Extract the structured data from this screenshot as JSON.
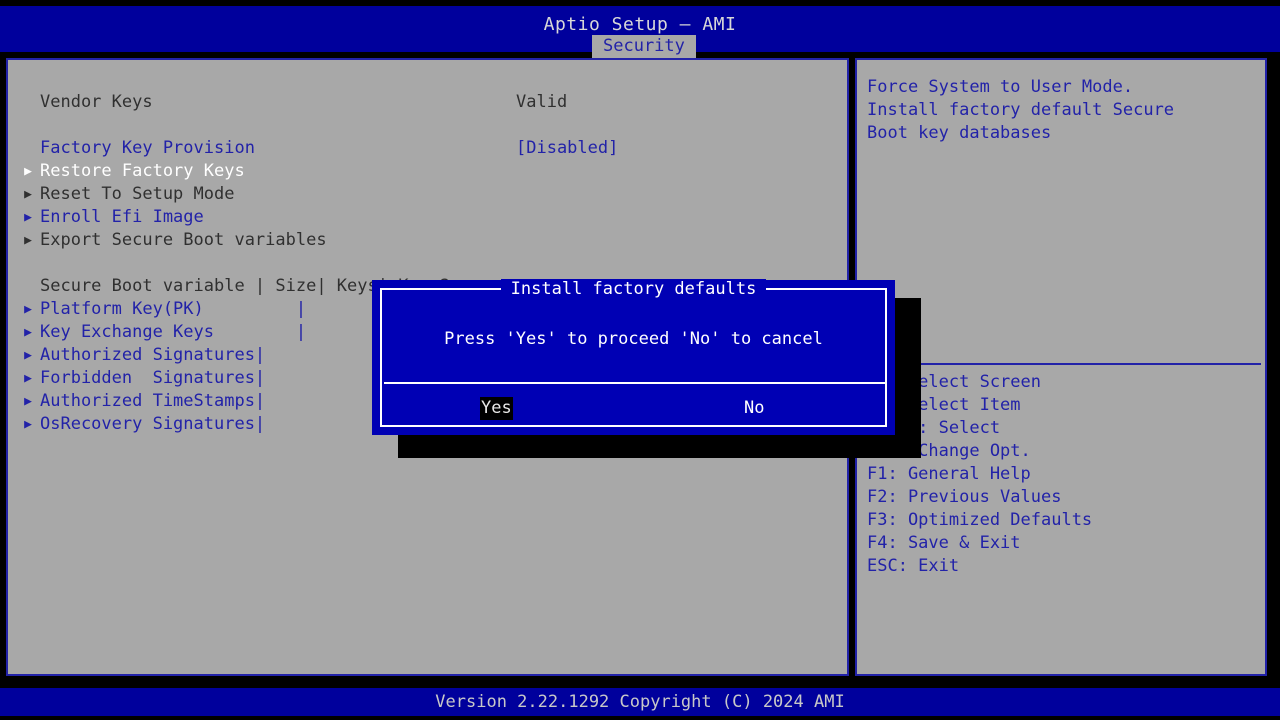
{
  "header": {
    "title": "Aptio Setup – AMI",
    "active_tab": "Security"
  },
  "left_panel": {
    "rows": [
      {
        "id": "vendor-keys",
        "arrow": "",
        "label": "Vendor Keys",
        "value": "Valid",
        "color": "dark",
        "interactable": false
      },
      {
        "id": "factory-key-provision",
        "arrow": "",
        "label": "Factory Key Provision",
        "value": "[Disabled]",
        "color": "blue",
        "interactable": true
      },
      {
        "id": "restore-factory-keys",
        "arrow": "▶",
        "label": "Restore Factory Keys",
        "value": "",
        "color": "white",
        "interactable": true
      },
      {
        "id": "reset-to-setup-mode",
        "arrow": "▶",
        "label": "Reset To Setup Mode",
        "value": "",
        "color": "dark",
        "interactable": true
      },
      {
        "id": "enroll-efi-image",
        "arrow": "▶",
        "label": "Enroll Efi Image",
        "value": "",
        "color": "blue",
        "interactable": true
      },
      {
        "id": "export-secure-boot-variables",
        "arrow": "▶",
        "label": "Export Secure Boot variables",
        "value": "",
        "color": "dark",
        "interactable": true
      },
      {
        "id": "secure-boot-variable-header",
        "arrow": "",
        "label": "Secure Boot variable | Size| Keys| Key Source",
        "value": "",
        "color": "dark",
        "interactable": false
      },
      {
        "id": "platform-key-pk",
        "arrow": "▶",
        "label": "Platform Key(PK)         |",
        "value": "",
        "color": "blue",
        "interactable": true
      },
      {
        "id": "key-exchange-keys",
        "arrow": "▶",
        "label": "Key Exchange Keys        |",
        "value": "",
        "color": "blue",
        "interactable": true
      },
      {
        "id": "authorized-signatures",
        "arrow": "▶",
        "label": "Authorized Signatures|",
        "value": "",
        "color": "blue",
        "interactable": true
      },
      {
        "id": "forbidden-signatures",
        "arrow": "▶",
        "label": "Forbidden  Signatures|",
        "value": "",
        "color": "blue",
        "interactable": true
      },
      {
        "id": "authorized-timestamps",
        "arrow": "▶",
        "label": "Authorized TimeStamps|",
        "value": "",
        "color": "blue",
        "interactable": true
      },
      {
        "id": "osrecovery-signatures",
        "arrow": "▶",
        "label": "OsRecovery Signatures|",
        "value": "",
        "color": "blue",
        "interactable": true
      }
    ]
  },
  "right_panel": {
    "help_text": "Force System to User Mode.\nInstall factory default Secure\nBoot key databases",
    "key_legend": [
      "><: Select Screen",
      "^v: Select Item",
      "Enter: Select",
      "+/-: Change Opt.",
      "F1: General Help",
      "F2: Previous Values",
      "F3: Optimized Defaults",
      "F4: Save & Exit",
      "ESC: Exit"
    ]
  },
  "dialog": {
    "title": "Install factory defaults",
    "message": "Press 'Yes' to proceed 'No' to cancel",
    "yes_label": "Yes",
    "no_label": "No",
    "selected_button": "Yes"
  },
  "footer": {
    "version_text": "Version 2.22.1292 Copyright (C) 2024 AMI"
  },
  "colors": {
    "background": "#000000",
    "bar_blue": "#00009c",
    "panel_gray": "#a8a8a8",
    "text_blue": "#2222a8",
    "text_dark": "#303030",
    "text_white": "#ffffff",
    "dialog_blue": "#0000b4",
    "shadow": "#000000"
  }
}
